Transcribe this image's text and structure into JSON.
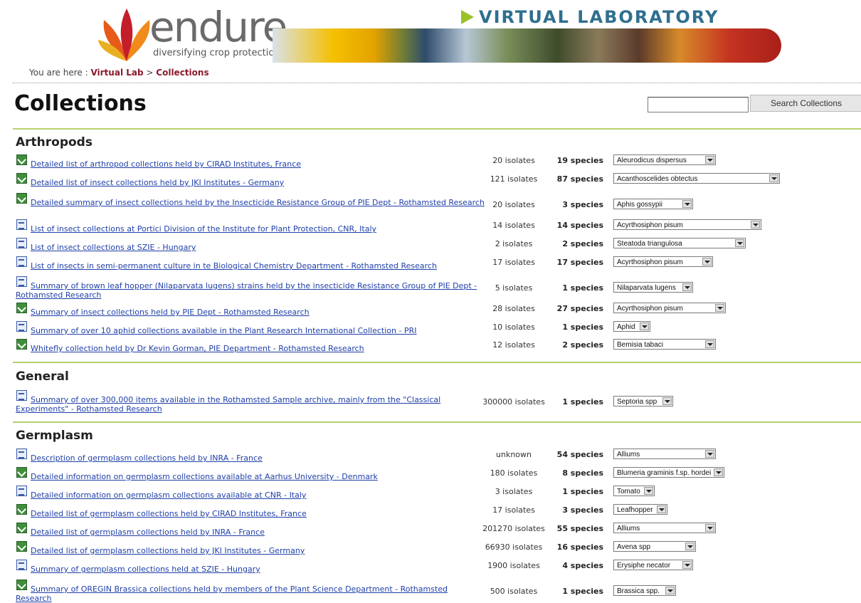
{
  "header": {
    "logo_word": "endure",
    "logo_tagline": "diversifying crop protection",
    "section_title": "VIRTUAL LABORATORY"
  },
  "breadcrumb": {
    "prefix": "You are here :",
    "items": [
      "Virtual Lab",
      "Collections"
    ],
    "separator": ">"
  },
  "page_title": "Collections",
  "search": {
    "value": "",
    "button_label": "Search Collections"
  },
  "sections": [
    {
      "title": "Arthropods",
      "rows": [
        {
          "icon": "excel-icon",
          "link": "Detailed list of arthropod collections held by CIRAD Institutes, France",
          "isolates": "20 isolates",
          "species": "19 species",
          "selected": "Aleurodicus dispersus"
        },
        {
          "icon": "excel-icon",
          "link": "Detailed list of insect collections held by JKI Institutes - Germany",
          "isolates": "121 isolates",
          "species": "87 species",
          "selected": "Acanthoscelides obtectus"
        },
        {
          "icon": "excel-icon",
          "link": "Detailed summary of insect collections held by the Insecticide Resistance Group of PIE Dept - Rothamsted Research",
          "isolates": "20 isolates",
          "species": "3 species",
          "selected": "Aphis gossypii"
        },
        {
          "icon": "word-icon",
          "link": "List of insect collections at Portici Division of the Institute for Plant Protection, CNR, Italy",
          "isolates": "14 isolates",
          "species": "14 species",
          "selected": "Acyrthosiphon pisum"
        },
        {
          "icon": "word-icon",
          "link": "List of insect collections at SZIE - Hungary",
          "isolates": "2 isolates",
          "species": "2 species",
          "selected": "Steatoda triangulosa"
        },
        {
          "icon": "word-icon",
          "link": "List of insects in semi-permanent culture in te Biological Chemistry Department - Rothamsted Research",
          "isolates": "17 isolates",
          "species": "17 species",
          "selected": "Acyrthosiphon pisum"
        },
        {
          "icon": "word-icon",
          "link": "Summary of brown leaf hopper (Nilaparvata lugens) strains held by the insecticide Resistance Group of PIE Dept - Rothamsted Research",
          "isolates": "5 isolates",
          "species": "1 species",
          "selected": "Nilaparvata lugens"
        },
        {
          "icon": "excel-icon",
          "link": "Summary of insect collections held by PIE Dept - Rothamsted Research",
          "isolates": "28 isolates",
          "species": "27 species",
          "selected": "Acyrthosiphon pisum"
        },
        {
          "icon": "word-icon",
          "link": "Summary of over 10 aphid collections available in the Plant Research International Collection - PRI",
          "isolates": "10 isolates",
          "species": "1 species",
          "selected": "Aphid"
        },
        {
          "icon": "excel-icon",
          "link": "Whitefly collection held by Dr Kevin Gorman, PIE Department - Rothamsted Research",
          "isolates": "12 isolates",
          "species": "2 species",
          "selected": "Bemisia tabaci"
        }
      ]
    },
    {
      "title": "General",
      "rows": [
        {
          "icon": "word-icon",
          "link": "Summary of over 300,000 items available in the Rothamsted Sample archive, mainly from the \"Classical Experiments\" - Rothamsted Research",
          "isolates": "300000 isolates",
          "species": "1 species",
          "selected": "Septoria spp"
        }
      ]
    },
    {
      "title": "Germplasm",
      "rows": [
        {
          "icon": "word-icon",
          "link": "Description of germplasm collections held by INRA - France",
          "isolates": "unknown",
          "species": "54 species",
          "selected": "Alliums"
        },
        {
          "icon": "excel-icon",
          "link": "Detailed information on germplasm collections available at Aarhus University - Denmark",
          "isolates": "180 isolates",
          "species": "8 species",
          "selected": "Blumeria graminis f.sp. hordei"
        },
        {
          "icon": "word-icon",
          "link": "Detailed information on germplasm collections available at CNR - Italy",
          "isolates": "3 isolates",
          "species": "1 species",
          "selected": "Tomato"
        },
        {
          "icon": "excel-icon",
          "link": "Detailed list of germplasm collections held by CIRAD Institutes, France",
          "isolates": "17 isolates",
          "species": "3 species",
          "selected": "Leafhopper"
        },
        {
          "icon": "excel-icon",
          "link": "Detailed list of germplasm collections held by INRA - France",
          "isolates": "201270 isolates",
          "species": "55 species",
          "selected": "Alliums"
        },
        {
          "icon": "excel-icon",
          "link": "Detailed list of germplasm collections held by JKI Institutes - Germany",
          "isolates": "66930 isolates",
          "species": "16 species",
          "selected": "Avena spp"
        },
        {
          "icon": "word-icon",
          "link": "Summary of germplasm collections held at SZIE - Hungary",
          "isolates": "1900 isolates",
          "species": "4 species",
          "selected": "Erysiphe necator"
        },
        {
          "icon": "excel-icon",
          "link": "Summary of OREGIN Brassica collections held by members of the Plant Science Department - Rothamsted Research",
          "isolates": "500 isolates",
          "species": "1 species",
          "selected": "Brassica spp."
        }
      ]
    }
  ]
}
